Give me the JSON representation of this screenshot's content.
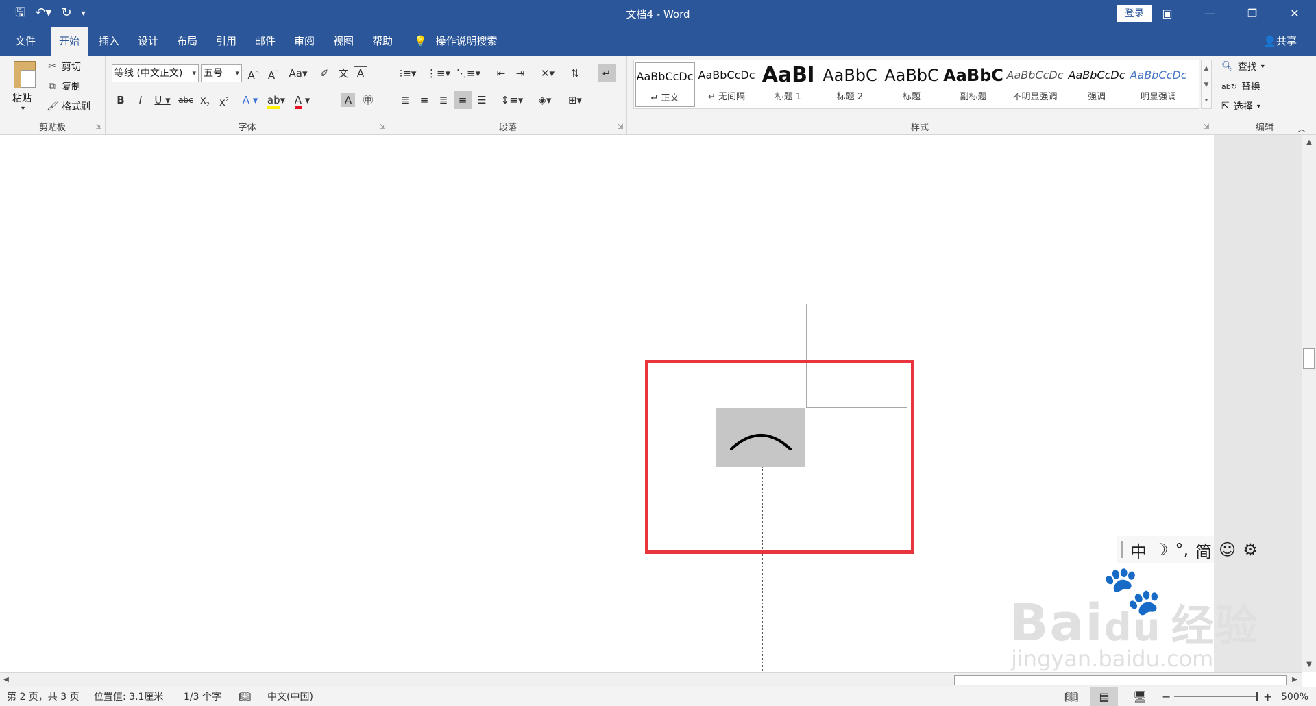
{
  "titlebar": {
    "title": "文档4  -  Word",
    "login": "登录",
    "qat_icons": [
      "save-icon",
      "undo-icon",
      "redo-icon",
      "customize-icon"
    ]
  },
  "tabs": [
    "文件",
    "开始",
    "插入",
    "设计",
    "布局",
    "引用",
    "邮件",
    "审阅",
    "视图",
    "帮助"
  ],
  "tell_me": "操作说明搜索",
  "share": "共享",
  "ribbon": {
    "clipboard": {
      "paste": "粘贴",
      "cut": "剪切",
      "copy": "复制",
      "format_painter": "格式刷",
      "label": "剪贴板"
    },
    "font": {
      "font_name": "等线 (中文正文)",
      "font_size": "五号",
      "label": "字体"
    },
    "paragraph": {
      "label": "段落"
    },
    "styles": {
      "label": "样式",
      "items": [
        {
          "sample": "AaBbCcDc",
          "name": "↵ 正文"
        },
        {
          "sample": "AaBbCcDc",
          "name": "↵ 无间隔"
        },
        {
          "sample": "AaBl",
          "name": "标题 1"
        },
        {
          "sample": "AaBbC",
          "name": "标题 2"
        },
        {
          "sample": "AaBbC",
          "name": "标题"
        },
        {
          "sample": "AaBbC",
          "name": "副标题"
        },
        {
          "sample": "AaBbCcDc",
          "name": "不明显强调"
        },
        {
          "sample": "AaBbCcDc",
          "name": "强调"
        },
        {
          "sample": "AaBbCcDc",
          "name": "明显强调"
        }
      ]
    },
    "editing": {
      "find": "查找",
      "replace": "替换",
      "select": "选择",
      "label": "编辑"
    }
  },
  "document": {
    "content_symbol": "⌒"
  },
  "ime": {
    "items": [
      "中",
      "☽",
      "°,",
      "简",
      "☺",
      "⚙"
    ]
  },
  "watermark": {
    "brand": "Bai",
    "brand2": "du",
    "cn": "经验",
    "url": "jingyan.baidu.com"
  },
  "status": {
    "page": "第 2 页，共 3 页",
    "position": "位置值: 3.1厘米",
    "words": "1/3 个字",
    "language": "中文(中国)",
    "zoom": "500%",
    "minus": "−",
    "plus": "+"
  },
  "colors": {
    "brand_blue": "#2b579a",
    "highlight_red": "#e8343d"
  }
}
